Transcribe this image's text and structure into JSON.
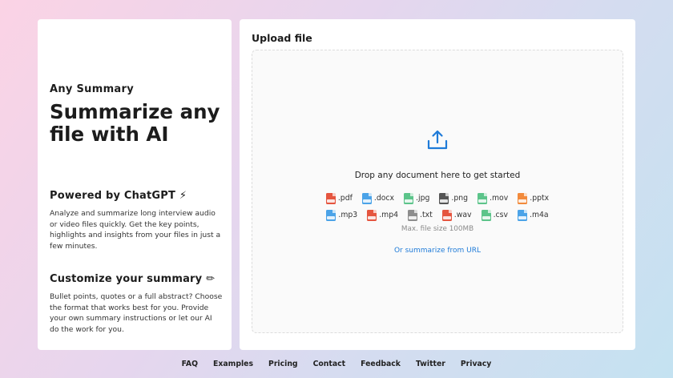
{
  "sidebar": {
    "brand": "Any Summary",
    "headline": "Summarize any file with AI",
    "powered": {
      "title": "Powered by ChatGPT",
      "emoji": "⚡",
      "text": "Analyze and summarize long interview audio or video files quickly. Get the key points, highlights and insights from your files in just a few minutes."
    },
    "customize": {
      "title": "Customize your summary",
      "emoji": "✏",
      "text": "Bullet points, quotes or a full abstract? Choose the format that works best for you. Provide your own summary instructions or let our AI do the work for you."
    }
  },
  "upload": {
    "title": "Upload file",
    "drop_text": "Drop any document here to get started",
    "upload_icon": "upload-icon",
    "filetypes_row1": [
      {
        "ext": ".pdf",
        "color": "#e5553f"
      },
      {
        "ext": ".docx",
        "color": "#4ba3e8"
      },
      {
        "ext": ".jpg",
        "color": "#5cc48a"
      },
      {
        "ext": ".png",
        "color": "#555555"
      },
      {
        "ext": ".mov",
        "color": "#5cc48a"
      },
      {
        "ext": ".pptx",
        "color": "#f28a3c"
      }
    ],
    "filetypes_row2": [
      {
        "ext": ".mp3",
        "color": "#4ba3e8"
      },
      {
        "ext": ".mp4",
        "color": "#e5553f"
      },
      {
        "ext": ".txt",
        "color": "#8d8d8d"
      },
      {
        "ext": ".wav",
        "color": "#e5553f"
      },
      {
        "ext": ".csv",
        "color": "#5cc48a"
      },
      {
        "ext": ".m4a",
        "color": "#4ba3e8"
      }
    ],
    "max_size": "Max. file size 100MB",
    "url_link": "Or summarize from URL",
    "accent": "#1f7bd8"
  },
  "footer": {
    "links": [
      "FAQ",
      "Examples",
      "Pricing",
      "Contact",
      "Feedback",
      "Twitter",
      "Privacy"
    ]
  }
}
